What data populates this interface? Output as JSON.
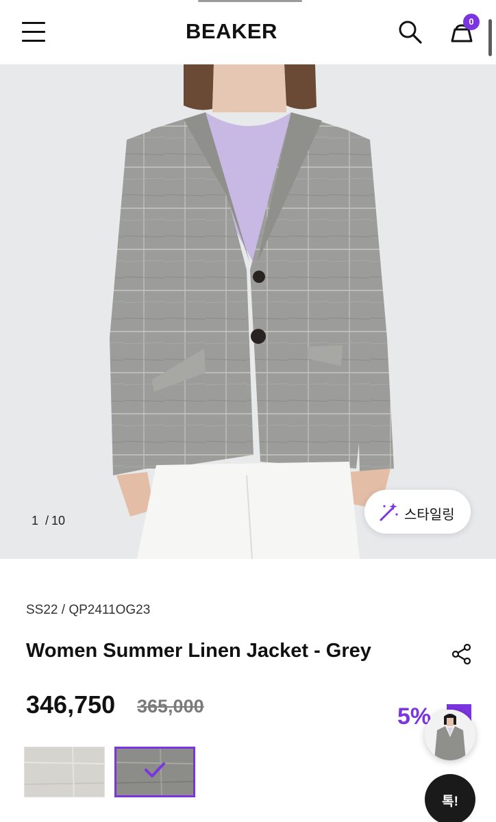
{
  "header": {
    "logo": "BEAKER",
    "cart_count": "0",
    "accent_color": "#7b35e0"
  },
  "gallery": {
    "current": "1",
    "separator": "/",
    "total": "10",
    "styling_label": "스타일링"
  },
  "product": {
    "code": "SS22 / QP2411OG23",
    "title": "Women Summer Linen Jacket - Grey",
    "price": "346,750",
    "original_price": "365,000",
    "discount": "5%"
  },
  "color_options": [
    {
      "name": "light-grey-swatch",
      "selected": false
    },
    {
      "name": "grey-swatch",
      "selected": true
    }
  ],
  "chat": {
    "label": "톡!"
  },
  "icons": [
    "menu-icon",
    "search-icon",
    "cart-icon",
    "magic-wand-icon",
    "share-icon",
    "check-icon"
  ]
}
